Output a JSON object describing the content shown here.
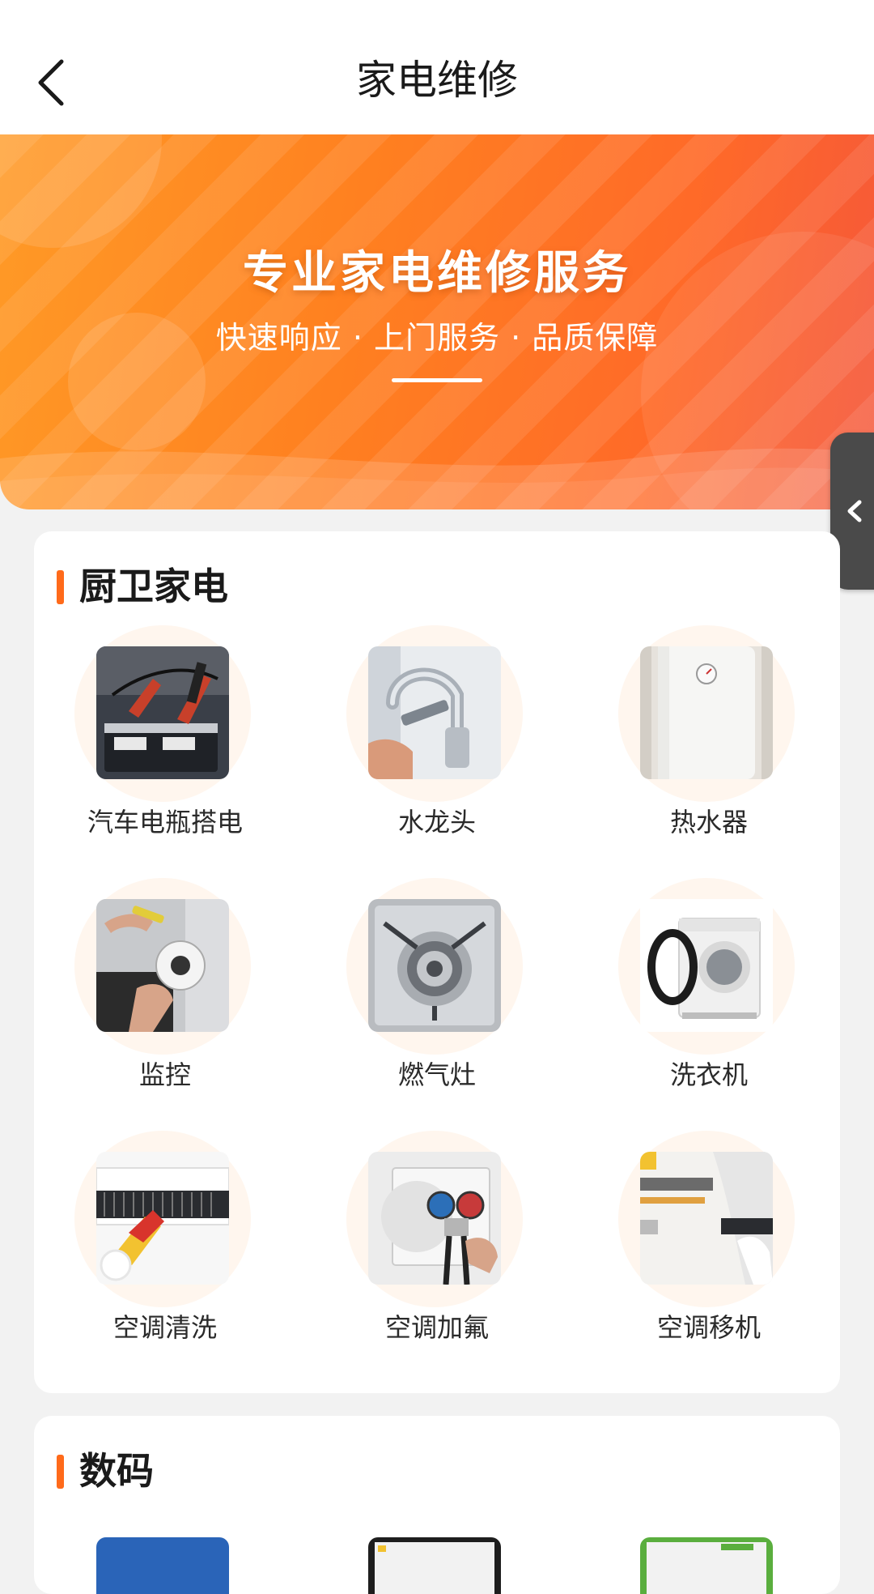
{
  "nav": {
    "title": "家电维修",
    "back_icon": "chevron-left-icon"
  },
  "hero": {
    "headline": "专业家电维修服务",
    "subline": "快速响应 · 上门服务 · 品质保障",
    "colors": {
      "start": "#ff9a26",
      "end": "#f5573a"
    }
  },
  "side_tab": {
    "icon": "chevron-left-icon"
  },
  "sections": [
    {
      "title": "厨卫家电",
      "items": [
        {
          "label": "汽车电瓶搭电",
          "icon": "car-battery-jumper-photo"
        },
        {
          "label": "水龙头",
          "icon": "faucet-photo"
        },
        {
          "label": "热水器",
          "icon": "water-heater-photo"
        },
        {
          "label": "监控",
          "icon": "security-camera-photo"
        },
        {
          "label": "燃气灶",
          "icon": "gas-stove-photo"
        },
        {
          "label": "洗衣机",
          "icon": "washing-machine-photo"
        },
        {
          "label": "空调清洗",
          "icon": "ac-cleaning-photo"
        },
        {
          "label": "空调加氟",
          "icon": "ac-refrigerant-photo"
        },
        {
          "label": "空调移机",
          "icon": "ac-relocation-photo"
        }
      ]
    },
    {
      "title": "数码",
      "items": []
    }
  ],
  "accent_color": "#ff6a1a"
}
